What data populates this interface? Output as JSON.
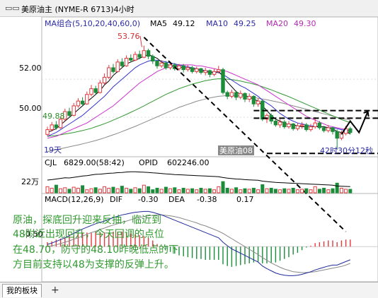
{
  "window": {
    "title_icon": "chart-window-icon",
    "title": "美原油主 (NYME-R 6713)4小时"
  },
  "tabs": {
    "active": "我的板块",
    "add": "+"
  },
  "colors": {
    "up": "#e0393e",
    "down": "#1a8c3a",
    "ma5": "#000000",
    "ma10": "#3333cc",
    "ma20": "#cc33cc",
    "ma40": "#339933",
    "ma60": "#8a8a8a",
    "dif": "#1f2a99",
    "dea": "#888888",
    "annotation": "#2f9a2f"
  },
  "chart_data": [
    {
      "type": "candlestick",
      "title": "MA组合(5,10,20,40,60,0)",
      "indicators": [
        {
          "name": "MA5",
          "value": "49.12"
        },
        {
          "name": "MA10",
          "value": "49.25"
        },
        {
          "name": "MA20",
          "value": "49.30"
        }
      ],
      "ylim": [
        48.0,
        54.6
      ],
      "yticks": [
        "52.00",
        "50.00"
      ],
      "high_label": "53.76",
      "low_ref_label": "49.88",
      "period_label": "19天",
      "contract_label": "美原油08",
      "countdown_label": "42时30分12秒",
      "candles": [
        [
          49.1,
          49.35,
          49.0,
          49.5
        ],
        [
          49.35,
          49.6,
          49.25,
          49.75
        ],
        [
          49.6,
          49.45,
          49.35,
          49.8
        ],
        [
          49.45,
          49.9,
          49.4,
          50.05
        ],
        [
          49.9,
          50.3,
          49.8,
          50.45
        ],
        [
          50.3,
          50.1,
          50.0,
          50.5
        ],
        [
          50.1,
          50.6,
          50.05,
          50.75
        ],
        [
          50.6,
          50.85,
          50.5,
          51.0
        ],
        [
          50.85,
          50.7,
          50.6,
          51.05
        ],
        [
          50.7,
          51.2,
          50.65,
          51.35
        ],
        [
          51.2,
          51.5,
          51.1,
          51.7
        ],
        [
          51.5,
          51.3,
          51.2,
          51.65
        ],
        [
          51.3,
          51.8,
          51.25,
          51.95
        ],
        [
          51.8,
          52.1,
          51.7,
          52.3
        ],
        [
          52.1,
          52.6,
          52.0,
          52.75
        ],
        [
          52.6,
          52.4,
          52.3,
          52.8
        ],
        [
          52.4,
          52.9,
          52.35,
          53.05
        ],
        [
          52.9,
          52.7,
          52.6,
          53.1
        ],
        [
          52.7,
          53.1,
          52.65,
          53.25
        ],
        [
          53.1,
          53.0,
          52.9,
          53.3
        ],
        [
          53.0,
          53.3,
          52.95,
          53.45
        ],
        [
          53.3,
          53.15,
          53.05,
          53.5
        ],
        [
          53.15,
          53.5,
          53.1,
          53.76
        ],
        [
          53.5,
          53.2,
          53.05,
          53.6
        ],
        [
          53.2,
          52.95,
          52.8,
          53.3
        ],
        [
          52.95,
          52.7,
          52.55,
          53.0
        ],
        [
          52.7,
          52.85,
          52.6,
          53.0
        ],
        [
          52.85,
          52.6,
          52.5,
          52.95
        ],
        [
          52.6,
          52.75,
          52.5,
          52.9
        ],
        [
          52.75,
          52.55,
          52.45,
          52.85
        ],
        [
          52.55,
          52.7,
          52.45,
          52.8
        ],
        [
          52.7,
          52.5,
          52.35,
          52.8
        ],
        [
          52.5,
          52.6,
          52.4,
          52.75
        ],
        [
          52.6,
          52.4,
          52.3,
          52.7
        ],
        [
          52.4,
          52.55,
          52.3,
          52.65
        ],
        [
          52.55,
          52.35,
          52.25,
          52.6
        ],
        [
          52.35,
          52.45,
          52.2,
          52.6
        ],
        [
          52.45,
          52.25,
          52.1,
          52.5
        ],
        [
          52.25,
          52.4,
          52.15,
          52.55
        ],
        [
          52.4,
          52.5,
          52.3,
          52.7
        ],
        [
          52.5,
          51.3,
          51.2,
          52.6
        ],
        [
          51.3,
          51.1,
          50.95,
          51.4
        ],
        [
          51.1,
          51.3,
          51.0,
          51.45
        ],
        [
          51.3,
          51.05,
          50.9,
          51.4
        ],
        [
          51.05,
          51.25,
          50.95,
          51.4
        ],
        [
          51.25,
          50.95,
          50.8,
          51.3
        ],
        [
          50.95,
          51.1,
          50.8,
          51.25
        ],
        [
          51.1,
          50.7,
          50.55,
          51.15
        ],
        [
          50.7,
          50.85,
          50.55,
          51.0
        ],
        [
          50.85,
          49.9,
          49.8,
          50.9
        ],
        [
          49.9,
          50.1,
          49.7,
          50.2
        ],
        [
          50.1,
          49.8,
          49.65,
          50.2
        ],
        [
          49.8,
          49.6,
          49.5,
          49.95
        ],
        [
          49.6,
          49.75,
          49.45,
          49.9
        ],
        [
          49.75,
          49.5,
          49.4,
          49.85
        ],
        [
          49.5,
          49.65,
          49.4,
          49.8
        ],
        [
          49.65,
          49.4,
          49.3,
          49.7
        ],
        [
          49.4,
          49.55,
          49.3,
          49.7
        ],
        [
          49.55,
          49.6,
          49.4,
          49.75
        ],
        [
          49.6,
          49.35,
          49.25,
          49.7
        ],
        [
          49.35,
          49.5,
          49.25,
          49.65
        ],
        [
          49.5,
          49.7,
          49.4,
          50.0
        ],
        [
          49.7,
          49.45,
          49.35,
          49.8
        ],
        [
          49.45,
          49.3,
          49.2,
          49.55
        ],
        [
          49.3,
          49.45,
          49.2,
          49.6
        ],
        [
          49.45,
          49.25,
          49.1,
          49.5
        ],
        [
          49.25,
          48.9,
          48.3,
          49.35
        ],
        [
          48.9,
          49.15,
          48.8,
          49.3
        ],
        [
          49.15,
          49.4,
          49.05,
          49.55
        ],
        [
          49.4,
          49.2,
          49.1,
          49.5
        ]
      ],
      "ma_series": [
        {
          "name": "MA5",
          "color": "#000000",
          "values": [
            49.2,
            49.3,
            49.4,
            49.6,
            49.8,
            50.0,
            50.2,
            50.4,
            50.6,
            50.8,
            51.0,
            51.2,
            51.4,
            51.7,
            51.9,
            52.2,
            52.4,
            52.6,
            52.8,
            52.9,
            53.0,
            53.1,
            53.2,
            53.3,
            53.2,
            53.1,
            52.9,
            52.8,
            52.7,
            52.7,
            52.65,
            52.6,
            52.6,
            52.55,
            52.5,
            52.45,
            52.4,
            52.35,
            52.35,
            52.4,
            52.15,
            51.85,
            51.6,
            51.35,
            51.2,
            51.15,
            51.05,
            50.95,
            50.85,
            50.6,
            50.35,
            50.1,
            49.9,
            49.8,
            49.7,
            49.6,
            49.6,
            49.55,
            49.5,
            49.5,
            49.5,
            49.5,
            49.5,
            49.5,
            49.45,
            49.4,
            49.25,
            49.2,
            49.25,
            49.12
          ]
        },
        {
          "name": "MA10",
          "color": "#3333cc",
          "values": [
            49.0,
            49.1,
            49.2,
            49.35,
            49.5,
            49.65,
            49.8,
            49.95,
            50.1,
            50.3,
            50.5,
            50.7,
            50.9,
            51.1,
            51.35,
            51.6,
            51.8,
            52.0,
            52.2,
            52.4,
            52.6,
            52.75,
            52.85,
            52.95,
            53.0,
            53.0,
            52.95,
            52.9,
            52.85,
            52.8,
            52.75,
            52.7,
            52.65,
            52.6,
            52.55,
            52.5,
            52.45,
            52.4,
            52.35,
            52.35,
            52.25,
            52.1,
            51.95,
            51.8,
            51.65,
            51.55,
            51.4,
            51.25,
            51.1,
            50.9,
            50.75,
            50.6,
            50.4,
            50.2,
            50.05,
            49.9,
            49.8,
            49.7,
            49.65,
            49.6,
            49.55,
            49.55,
            49.5,
            49.5,
            49.45,
            49.45,
            49.4,
            49.35,
            49.3,
            49.25
          ]
        },
        {
          "name": "MA20",
          "color": "#cc33cc",
          "values": [
            48.9,
            48.95,
            49.0,
            49.1,
            49.2,
            49.3,
            49.4,
            49.5,
            49.6,
            49.7,
            49.85,
            50.0,
            50.15,
            50.3,
            50.45,
            50.6,
            50.8,
            51.0,
            51.2,
            51.4,
            51.6,
            51.8,
            51.95,
            52.1,
            52.25,
            52.4,
            52.5,
            52.6,
            52.65,
            52.7,
            52.75,
            52.75,
            52.75,
            52.75,
            52.7,
            52.7,
            52.65,
            52.6,
            52.55,
            52.5,
            52.45,
            52.4,
            52.3,
            52.2,
            52.1,
            52.0,
            51.9,
            51.8,
            51.7,
            51.55,
            51.4,
            51.25,
            51.1,
            50.95,
            50.8,
            50.65,
            50.5,
            50.35,
            50.2,
            50.05,
            49.95,
            49.85,
            49.75,
            49.65,
            49.55,
            49.5,
            49.45,
            49.4,
            49.35,
            49.3
          ]
        },
        {
          "name": "MA40",
          "color": "#339933",
          "values": [
            49.0,
            49.02,
            49.05,
            49.08,
            49.12,
            49.16,
            49.2,
            49.25,
            49.3,
            49.36,
            49.42,
            49.5,
            49.58,
            49.66,
            49.75,
            49.85,
            49.95,
            50.05,
            50.15,
            50.26,
            50.37,
            50.48,
            50.6,
            50.72,
            50.84,
            50.96,
            51.08,
            51.2,
            51.3,
            51.4,
            51.5,
            51.58,
            51.66,
            51.74,
            51.8,
            51.86,
            51.92,
            51.96,
            52.0,
            52.02,
            52.02,
            52.0,
            51.98,
            51.94,
            51.9,
            51.85,
            51.8,
            51.74,
            51.68,
            51.6,
            51.52,
            51.44,
            51.35,
            51.26,
            51.17,
            51.08,
            50.98,
            50.88,
            50.78,
            50.68,
            50.58,
            50.48,
            50.38,
            50.28,
            50.18,
            50.08,
            49.98,
            49.88,
            49.8,
            49.72
          ]
        },
        {
          "name": "MA60",
          "color": "#8a8a8a",
          "values": [
            48.2,
            48.25,
            48.3,
            48.35,
            48.4,
            48.45,
            48.5,
            48.55,
            48.6,
            48.66,
            48.72,
            48.78,
            48.85,
            48.92,
            49.0,
            49.08,
            49.16,
            49.25,
            49.34,
            49.43,
            49.52,
            49.62,
            49.72,
            49.82,
            49.92,
            50.02,
            50.12,
            50.22,
            50.32,
            50.42,
            50.52,
            50.6,
            50.68,
            50.76,
            50.84,
            50.9,
            50.96,
            51.02,
            51.06,
            51.1,
            51.12,
            51.14,
            51.14,
            51.14,
            51.12,
            51.1,
            51.07,
            51.04,
            51.0,
            50.96,
            50.92,
            50.87,
            50.82,
            50.77,
            50.72,
            50.66,
            50.6,
            50.54,
            50.48,
            50.42,
            50.36,
            50.3,
            50.24,
            50.18,
            50.12,
            50.06,
            50.0,
            49.94,
            49.9,
            49.88
          ]
        }
      ],
      "guides": {
        "trendline_dashed": [
          [
            22,
            54.2
          ],
          [
            68,
            47.7
          ]
        ],
        "box_top": 50.35,
        "box_mid": 49.95,
        "box_bottom": 48.1,
        "box_start_index": 47,
        "projection_zigzag": [
          [
            67,
            49.1
          ],
          [
            69,
            49.8
          ],
          [
            71,
            49.2
          ],
          [
            73,
            50.3
          ]
        ]
      }
    },
    {
      "type": "bar",
      "title": "CJL",
      "cjl_value": "6829.00(58:42)",
      "opid_label": "OPID",
      "opid_value": "602246.00",
      "ytick": "22万",
      "ylim": [
        0,
        50000
      ],
      "values": [
        12000,
        9000,
        15000,
        8000,
        10000,
        7000,
        11000,
        9000,
        14000,
        6000,
        8000,
        10000,
        7000,
        12000,
        9000,
        11000,
        8000,
        13000,
        9000,
        7000,
        10000,
        8000,
        15000,
        12000,
        6000,
        9000,
        7000,
        11000,
        8000,
        10000,
        6000,
        9000,
        7000,
        8000,
        6000,
        9000,
        7000,
        8000,
        6000,
        12000,
        22000,
        9000,
        7000,
        10000,
        6000,
        8000,
        7000,
        9000,
        6000,
        16000,
        8000,
        9000,
        7000,
        6000,
        8000,
        7000,
        9000,
        6000,
        7000,
        8000,
        6000,
        12000,
        7000,
        9000,
        6000,
        8000,
        19000,
        9000,
        7000,
        6829
      ],
      "opid_values": [
        44000,
        44200,
        44500,
        44800,
        45100,
        45000,
        45300,
        45600,
        45900,
        46100,
        46400,
        46700,
        46800,
        47000,
        47200,
        47300,
        47500,
        47600,
        47800,
        47900,
        47900,
        47800,
        47700,
        47600,
        47400,
        47300,
        47100,
        46900,
        46800,
        46600,
        46500,
        46400,
        46300,
        46200,
        46100,
        46000,
        45900,
        45800,
        45700,
        45600,
        45200,
        44900,
        44700,
        44500,
        44400,
        44200,
        44100,
        44000,
        43900,
        43500,
        43300,
        43100,
        42900,
        42800,
        42700,
        42600,
        42500,
        42400,
        42300,
        42200,
        42100,
        42000,
        41900,
        41800,
        41700,
        41600,
        41200,
        41100,
        41000,
        40900
      ]
    },
    {
      "type": "line",
      "title": "MACD(12,26,9)",
      "dif_label": "DIF",
      "dif_value": "-0.30",
      "dea_label": "DEA",
      "dea_value": "-0.38",
      "macd_value": "0.17",
      "ytick": "-0.50",
      "ylim": [
        -0.75,
        0.95
      ],
      "dif": [
        0.05,
        0.08,
        0.12,
        0.16,
        0.2,
        0.25,
        0.3,
        0.35,
        0.4,
        0.44,
        0.48,
        0.52,
        0.55,
        0.58,
        0.62,
        0.66,
        0.69,
        0.72,
        0.74,
        0.76,
        0.78,
        0.79,
        0.8,
        0.8,
        0.78,
        0.75,
        0.72,
        0.68,
        0.64,
        0.6,
        0.56,
        0.52,
        0.48,
        0.44,
        0.4,
        0.36,
        0.32,
        0.28,
        0.24,
        0.2,
        0.1,
        0.02,
        -0.05,
        -0.1,
        -0.15,
        -0.2,
        -0.25,
        -0.3,
        -0.35,
        -0.44,
        -0.5,
        -0.55,
        -0.6,
        -0.63,
        -0.65,
        -0.66,
        -0.66,
        -0.65,
        -0.63,
        -0.6,
        -0.57,
        -0.53,
        -0.5,
        -0.47,
        -0.44,
        -0.42,
        -0.42,
        -0.38,
        -0.34,
        -0.3
      ],
      "dea": [
        0.0,
        0.02,
        0.04,
        0.07,
        0.1,
        0.13,
        0.17,
        0.2,
        0.24,
        0.28,
        0.32,
        0.35,
        0.39,
        0.42,
        0.46,
        0.49,
        0.52,
        0.55,
        0.58,
        0.61,
        0.64,
        0.66,
        0.68,
        0.7,
        0.71,
        0.72,
        0.72,
        0.71,
        0.7,
        0.68,
        0.66,
        0.63,
        0.6,
        0.57,
        0.54,
        0.5,
        0.47,
        0.43,
        0.39,
        0.35,
        0.3,
        0.24,
        0.18,
        0.12,
        0.06,
        0.0,
        -0.06,
        -0.12,
        -0.18,
        -0.25,
        -0.31,
        -0.37,
        -0.42,
        -0.47,
        -0.51,
        -0.54,
        -0.57,
        -0.58,
        -0.59,
        -0.59,
        -0.58,
        -0.57,
        -0.55,
        -0.53,
        -0.51,
        -0.49,
        -0.47,
        -0.45,
        -0.42,
        -0.38
      ]
    }
  ],
  "annotation": {
    "line1": "原油，探底回升迎来反抽，临近到",
    "line2": "48附近出现回升，今天回调的点位",
    "line3": "在48.70，防守的48.10昨晚低点的下",
    "line4": "方目前支持以48为支撑的反弹上升。"
  }
}
